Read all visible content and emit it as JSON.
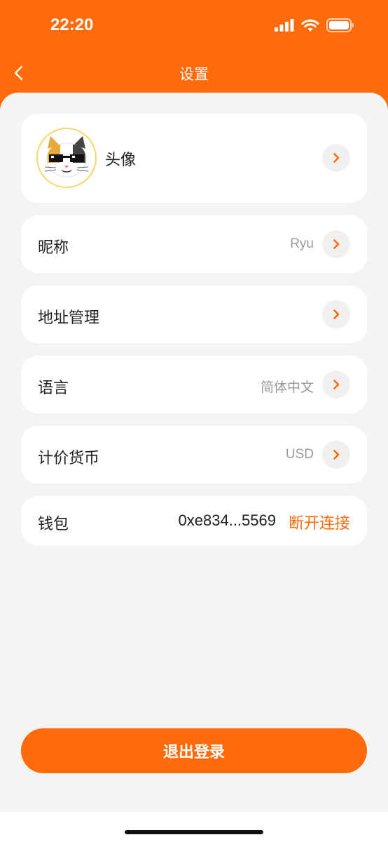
{
  "status_bar": {
    "time": "22:20"
  },
  "nav": {
    "title": "设置"
  },
  "settings": {
    "avatar_label": "头像",
    "nickname": {
      "label": "昵称",
      "value": "Ryu"
    },
    "address": {
      "label": "地址管理"
    },
    "language": {
      "label": "语言",
      "value": "简体中文"
    },
    "currency": {
      "label": "计价货币",
      "value": "USD"
    },
    "wallet": {
      "label": "钱包",
      "address": "0xe834...5569",
      "disconnect_label": "断开连接"
    }
  },
  "logout_label": "退出登录",
  "colors": {
    "accent": "#ff6a0a",
    "background": "#f5f4f3",
    "card": "#ffffff"
  }
}
